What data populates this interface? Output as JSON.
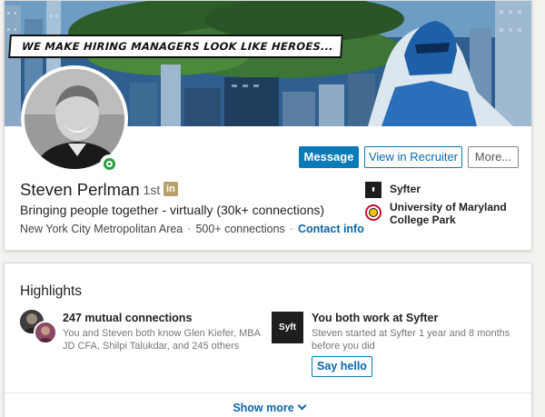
{
  "banner": {
    "tagline": "WE MAKE HIRING MANAGERS LOOK LIKE HEROES..."
  },
  "profile": {
    "name": "Steven Perlman",
    "degree": "· 1st",
    "linkedin_badge": "in",
    "headline": "Bringing people together - virtually (30k+ connections)",
    "location": "New York City Metropolitan Area",
    "connections": "500+ connections",
    "contact_info": "Contact info",
    "online_status_color": "#2c9f44"
  },
  "actions": {
    "message": "Message",
    "view_in_recruiter": "View in Recruiter",
    "more": "More..."
  },
  "experience": {
    "company": "Syfter",
    "school": "University of Maryland College Park"
  },
  "highlights": {
    "title": "Highlights",
    "mutual": {
      "title": "247 mutual connections",
      "description": "You and Steven both know Glen Kiefer, MBA JD CFA, Shilpi Talukdar, and 245 others"
    },
    "work": {
      "logo_text": "Syft",
      "title": "You both work at Syfter",
      "description": "Steven started at Syfter 1 year and 8 months before you did",
      "button": "Say hello"
    },
    "show_more": "Show more"
  },
  "colors": {
    "primary": "#0a7bb7",
    "link": "#0a66a8",
    "background": "#f3f2ef"
  }
}
